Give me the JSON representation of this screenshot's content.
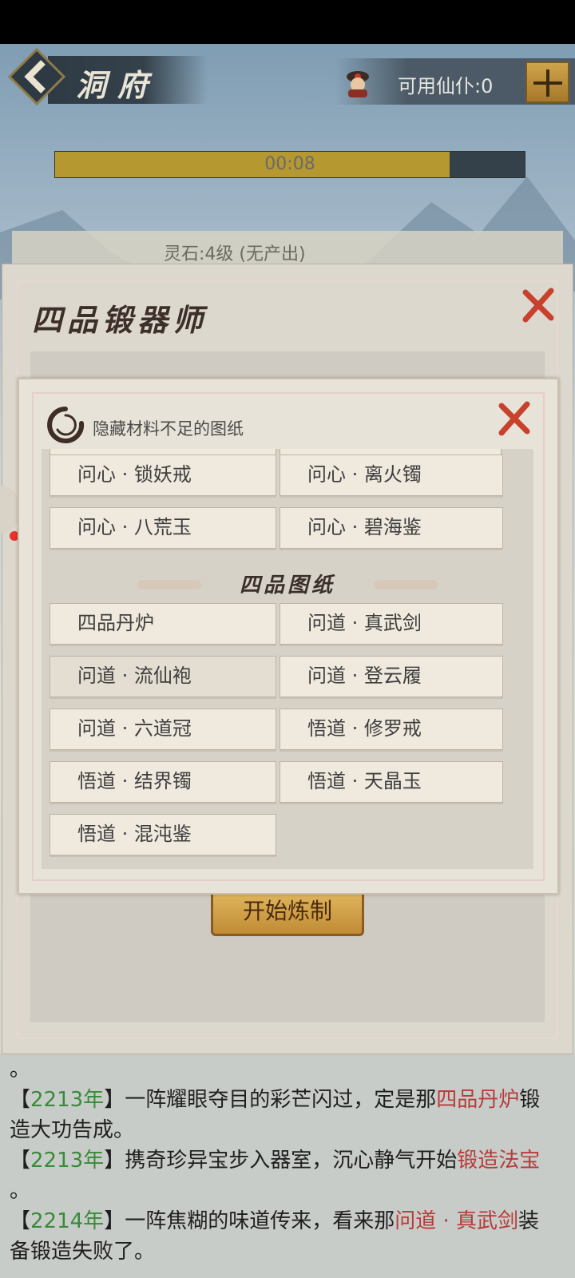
{
  "header": {
    "title": "洞府",
    "servant_label": "可用仙仆:0"
  },
  "progress": {
    "time": "00:08",
    "fraction": 0.84
  },
  "stone": {
    "text": "灵石:4级 (无产出)"
  },
  "forge_dialog": {
    "title": "四品锻器师",
    "start_button": "开始炼制"
  },
  "blueprint_dialog": {
    "filter_label": "隐藏材料不足的图纸",
    "top_items": [
      "问心 · 锁妖戒",
      "问心 · 离火镯",
      "问心 · 八荒玉",
      "问心 · 碧海鉴"
    ],
    "section_title": "四品图纸",
    "items": [
      "四品丹炉",
      "问道 · 真武剑",
      "问道 · 流仙袍",
      "问道 · 登云履",
      "问道 · 六道冠",
      "悟道 · 修罗戒",
      "悟道 · 结界镯",
      "悟道 · 天晶玉",
      "悟道 · 混沌鉴"
    ]
  },
  "log": {
    "line0": "。",
    "l1_open": "【",
    "l1_year": "2213年",
    "l1_mid": "】一阵耀眼夺目的彩芒闪过，定是那",
    "l1_hl": "四品丹炉",
    "l1_end": "锻",
    "l2": "造大功告成。",
    "l3_open": "【",
    "l3_year": "2213年",
    "l3_mid": "】携奇珍异宝步入器室，沉心静气开始",
    "l3_hl": "锻造法宝",
    "l4": "。",
    "l5_open": "【",
    "l5_year": "2214年",
    "l5_mid": "】一阵焦糊的味道传来，看来那",
    "l5_hl": "问道 · 真武剑",
    "l5_end": "装",
    "l6": "备锻造失败了。"
  },
  "colors": {
    "year_green": "#3a8a3a",
    "highlight_red": "#b83a3a",
    "gold": "#b5982f"
  },
  "icons": [
    "back-arrow-icon",
    "servant-avatar-icon",
    "plus-icon",
    "close-icon",
    "filter-ring-icon"
  ]
}
